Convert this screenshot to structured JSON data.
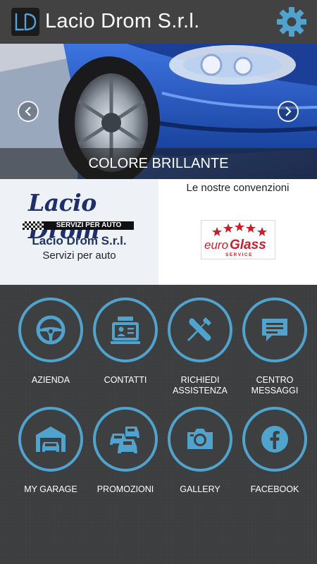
{
  "header": {
    "title": "Lacio Drom S.r.l.",
    "logo_text": "LD"
  },
  "banner": {
    "caption": "COLORE BRILLANTE",
    "prev_icon": "chevron-left-icon",
    "next_icon": "chevron-right-icon"
  },
  "company": {
    "logo_text": "Lacio Drom",
    "logo_tagline": "SERVIZI PER AUTO",
    "name": "Lacio Drom S.r.l.",
    "subtitle": "Servizi per auto"
  },
  "conventions": {
    "title": "Le nostre convenzioni",
    "partner_logo_text": "euroGlass",
    "partner_logo_sub": "SERVICE"
  },
  "menu": [
    {
      "label": "AZIENDA",
      "icon": "steering-wheel-icon"
    },
    {
      "label": "CONTATTI",
      "icon": "contact-card-icon"
    },
    {
      "label": "RICHIEDI ASSISTENZA",
      "icon": "tools-icon"
    },
    {
      "label": "CENTRO MESSAGGI",
      "icon": "message-icon"
    },
    {
      "label": "MY GARAGE",
      "icon": "garage-icon"
    },
    {
      "label": "PROMOZIONI",
      "icon": "cars-icon"
    },
    {
      "label": "GALLERY",
      "icon": "camera-icon"
    },
    {
      "label": "FACEBOOK",
      "icon": "facebook-icon"
    }
  ],
  "colors": {
    "accent": "#4fa3cd",
    "header_bg": "#424242",
    "grid_bg": "#3d3e40",
    "brand_blue": "#1e2f6b",
    "euroglass_red": "#c8202a"
  }
}
